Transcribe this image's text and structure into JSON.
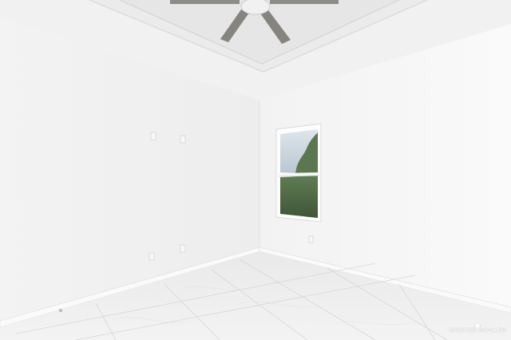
{
  "watermark": {
    "text": "GREATER MCALLEN"
  },
  "colors": {
    "left_wall": "#f1f1f1",
    "right_wall": "#f7f7f7",
    "ceiling": "#f2f2f2",
    "tray": "#e9e9e9",
    "floor": "#ececec",
    "fan": "#8c8a86",
    "window_frame": "#fbfbfb",
    "sky": "#c9d4de",
    "trees": "#4f6a45"
  }
}
